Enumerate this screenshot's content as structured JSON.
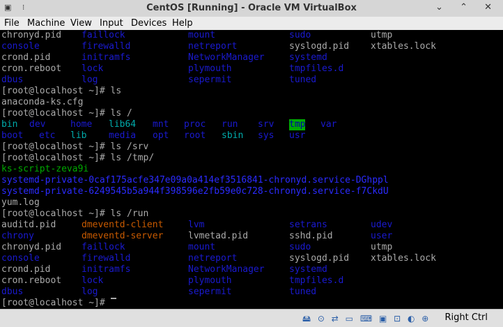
{
  "window": {
    "title": "CentOS [Running] - Oracle VM VirtualBox",
    "left_controls": "▣ ⁝",
    "right_controls": "⌄ ⌃ ✕"
  },
  "menu": [
    "File",
    "Machine",
    "View",
    "Input",
    "Devices",
    "Help"
  ],
  "terminal": {
    "lines": [
      [
        [
          "chronyd.pid",
          "w",
          0
        ],
        [
          "faillock",
          "b",
          115
        ],
        [
          "mount",
          "b",
          268
        ],
        [
          "sudo",
          "b",
          413
        ],
        [
          "utmp",
          "w",
          530
        ]
      ],
      [
        [
          "console",
          "b",
          0
        ],
        [
          "firewalld",
          "b",
          115
        ],
        [
          "netreport",
          "b",
          268
        ],
        [
          "syslogd.pid",
          "w",
          413
        ],
        [
          "xtables.lock",
          "w",
          530
        ]
      ],
      [
        [
          "crond.pid",
          "w",
          0
        ],
        [
          "initramfs",
          "b",
          115
        ],
        [
          "NetworkManager",
          "b",
          268
        ],
        [
          "systemd",
          "b",
          413
        ]
      ],
      [
        [
          "cron.reboot",
          "w",
          0
        ],
        [
          "lock",
          "b",
          115
        ],
        [
          "plymouth",
          "b",
          268
        ],
        [
          "tmpfiles.d",
          "b",
          413
        ]
      ],
      [
        [
          "dbus",
          "b",
          0
        ],
        [
          "log",
          "b",
          115
        ],
        [
          "sepermit",
          "b",
          268
        ],
        [
          "tuned",
          "b",
          413
        ]
      ],
      [
        [
          "[root@localhost ~]# ls",
          "w",
          0
        ]
      ],
      [
        [
          "anaconda-ks.cfg",
          "w",
          0
        ]
      ],
      [
        [
          "[root@localhost ~]# ls /",
          "w",
          0
        ]
      ],
      [
        [
          "bin",
          "c",
          0
        ],
        [
          "dev",
          "b",
          40
        ],
        [
          "home",
          "b",
          99
        ],
        [
          "lib64",
          "c",
          154
        ],
        [
          "mnt",
          "b",
          217
        ],
        [
          "proc",
          "b",
          262
        ],
        [
          "run",
          "b",
          316
        ],
        [
          "srv",
          "b",
          368
        ],
        [
          "tmp",
          "hl",
          413
        ],
        [
          "var",
          "b",
          458
        ]
      ],
      [
        [
          "boot",
          "b",
          0
        ],
        [
          "etc",
          "b",
          54
        ],
        [
          "lib",
          "c",
          99
        ],
        [
          "media",
          "b",
          154
        ],
        [
          "opt",
          "b",
          217
        ],
        [
          "root",
          "b",
          262
        ],
        [
          "sbin",
          "c",
          316
        ],
        [
          "sys",
          "b",
          368
        ],
        [
          "usr",
          "b",
          413
        ]
      ],
      [
        [
          "[root@localhost ~]# ls /srv",
          "w",
          0
        ]
      ],
      [
        [
          "[root@localhost ~]# ls /tmp/",
          "w",
          0
        ]
      ],
      [
        [
          "ks-script-zeva9i",
          "g",
          0
        ]
      ],
      [
        [
          "systemd-private-0caf175acfe347e09a0a414ef3516841-chronyd.service-DGhppl",
          "bb",
          0
        ]
      ],
      [
        [
          "systemd-private-6249545b5a944f398596e2fb59e0c728-chronyd.service-f7CkdU",
          "bb",
          0
        ]
      ],
      [
        [
          "yum.log",
          "w",
          0
        ]
      ],
      [
        [
          "[root@localhost ~]# ls /run",
          "w",
          0
        ]
      ],
      [
        [
          "auditd.pid",
          "w",
          0
        ],
        [
          "dmeventd-client",
          "o",
          115
        ],
        [
          "lvm",
          "b",
          268
        ],
        [
          "setrans",
          "b",
          413
        ],
        [
          "udev",
          "b",
          530
        ]
      ],
      [
        [
          "chrony",
          "b",
          0
        ],
        [
          "dmeventd-server",
          "o",
          115
        ],
        [
          "lvmetad.pid",
          "w",
          268
        ],
        [
          "sshd.pid",
          "w",
          413
        ],
        [
          "user",
          "b",
          530
        ]
      ],
      [
        [
          "chronyd.pid",
          "w",
          0
        ],
        [
          "faillock",
          "b",
          115
        ],
        [
          "mount",
          "b",
          268
        ],
        [
          "sudo",
          "b",
          413
        ],
        [
          "utmp",
          "w",
          530
        ]
      ],
      [
        [
          "console",
          "b",
          0
        ],
        [
          "firewalld",
          "b",
          115
        ],
        [
          "netreport",
          "b",
          268
        ],
        [
          "syslogd.pid",
          "w",
          413
        ],
        [
          "xtables.lock",
          "w",
          530
        ]
      ],
      [
        [
          "crond.pid",
          "w",
          0
        ],
        [
          "initramfs",
          "b",
          115
        ],
        [
          "NetworkManager",
          "b",
          268
        ],
        [
          "systemd",
          "b",
          413
        ]
      ],
      [
        [
          "cron.reboot",
          "w",
          0
        ],
        [
          "lock",
          "b",
          115
        ],
        [
          "plymouth",
          "b",
          268
        ],
        [
          "tmpfiles.d",
          "b",
          413
        ]
      ],
      [
        [
          "dbus",
          "b",
          0
        ],
        [
          "log",
          "b",
          115
        ],
        [
          "sepermit",
          "b",
          268
        ],
        [
          "tuned",
          "b",
          413
        ]
      ],
      [
        [
          "[root@localhost ~]# ",
          "w",
          0
        ]
      ]
    ]
  },
  "status": {
    "device_icons": "🖴 ⊙ ⇄ ▭ ⌨ ▣ ⊡ ◐ ⊕",
    "host_key": "Right Ctrl"
  }
}
